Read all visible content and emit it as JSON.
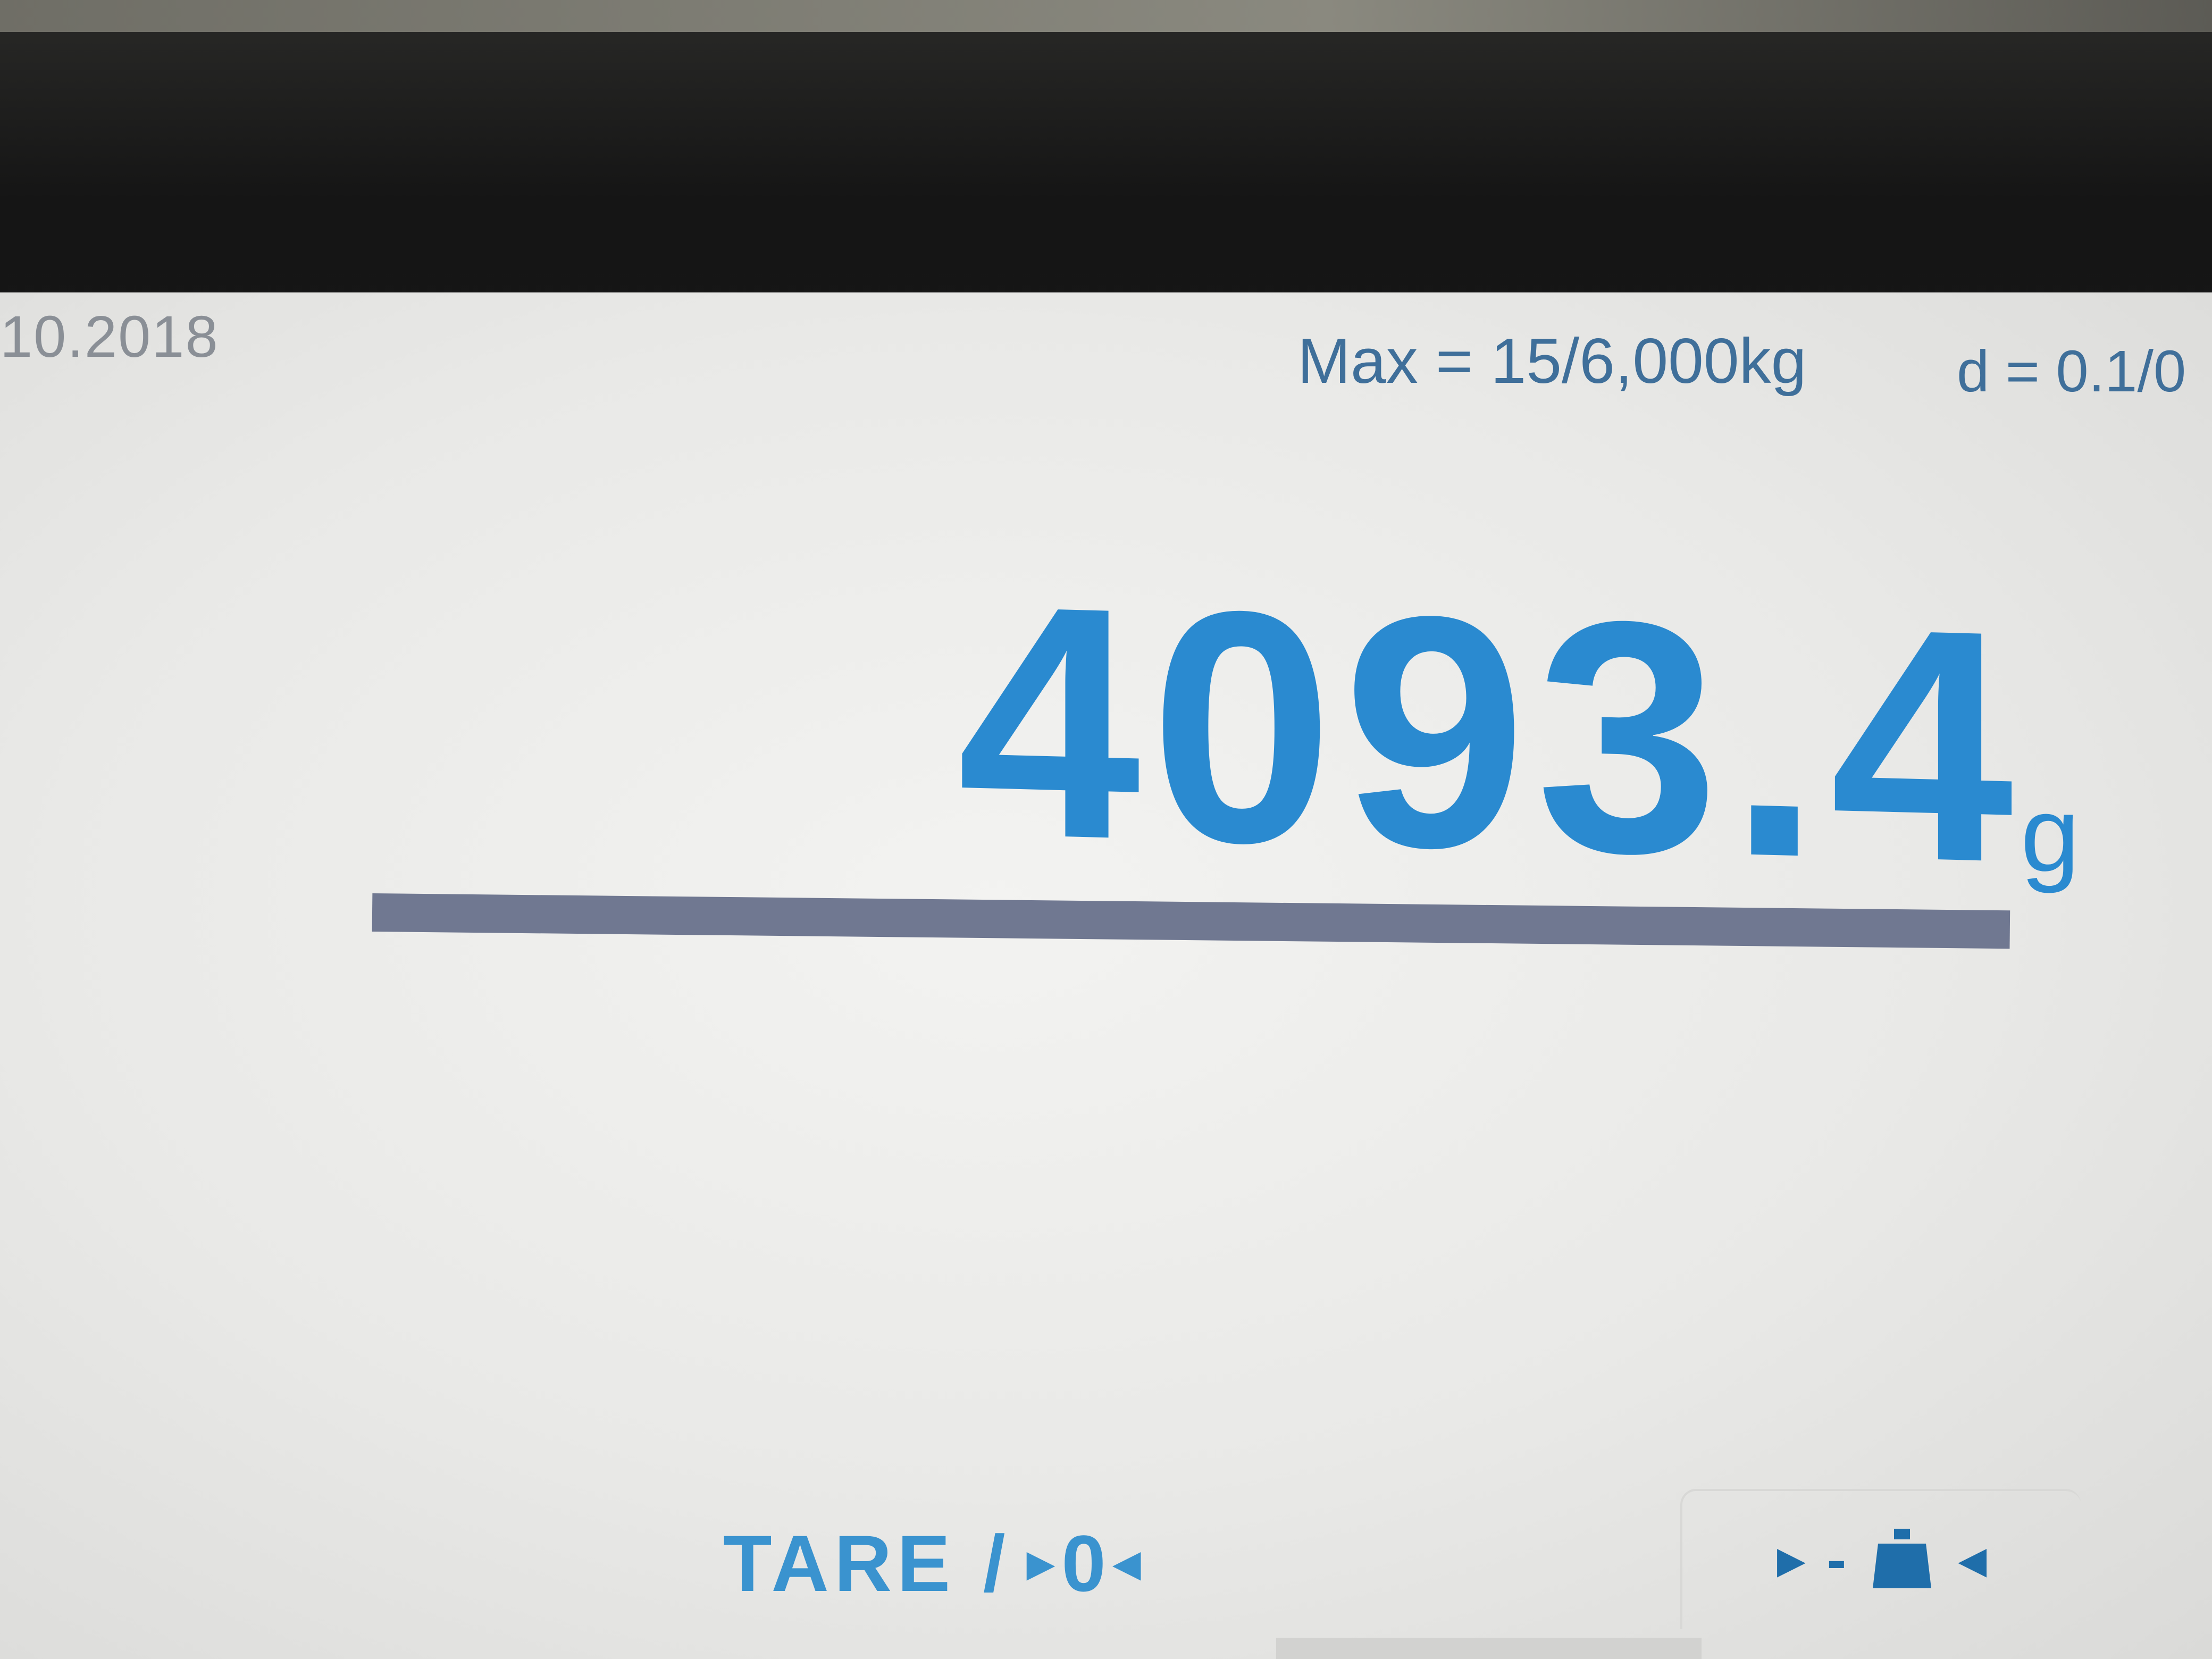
{
  "header": {
    "date_fragment": "10.2018",
    "max_label": "Max = 15/6,000kg",
    "d_label": "d = 0.1/0"
  },
  "reading": {
    "value": "4093.4",
    "unit": "g"
  },
  "capacity_bar": {
    "fill_fraction": 1.0,
    "color": "#707891"
  },
  "softkeys": {
    "tare_label": "TARE /",
    "zero_label": "0",
    "weight_icon": "weight-icon",
    "dash": "-"
  },
  "colors": {
    "reading": "#2a8ad0",
    "header_text": "#3f6f9a",
    "softkey": "#3a93cf"
  }
}
